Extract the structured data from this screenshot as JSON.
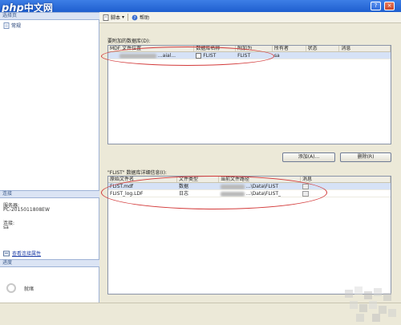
{
  "brand": {
    "prefix": "php",
    "suffix": "中文网"
  },
  "window_controls": {
    "help": "?",
    "close": "×"
  },
  "left_pane": {
    "select_page_header": "选择页",
    "select_page_item": "常规",
    "connection_header": "连接",
    "server_label": "服务器:",
    "server_value": "PC-2015011808EW",
    "connection_label": "连接:",
    "connection_value": "sa",
    "view_connection_link": "查看连接属性",
    "progress_header": "进度",
    "progress_status": "就绪"
  },
  "toolbar": {
    "script_label": "脚本",
    "help_label": "帮助"
  },
  "attach_section": {
    "label": "要附加的数据库(D):",
    "columns": [
      "MDF 文件位置",
      "数据库名称",
      "附加为",
      "所有者",
      "状态",
      "消息"
    ],
    "rows": [
      {
        "mdf": "...aial...",
        "db_name": "FLIST",
        "attach_as": "FLIST",
        "owner": "sa",
        "status": "",
        "message": ""
      }
    ]
  },
  "buttons": {
    "add": "添加(A)...",
    "remove": "删除(R)"
  },
  "details_section": {
    "label": "\"FLIST\" 数据库详细信息(I):",
    "columns": [
      "原始文件名",
      "文件类型",
      "当前文件路径",
      "消息"
    ],
    "rows": [
      {
        "file_name": "FLIST.mdf",
        "file_type": "数据",
        "path": "...\\Data\\FLIST",
        "message": ""
      },
      {
        "file_name": "FLIST_log.LDF",
        "file_type": "日志",
        "path": "...\\Data\\FLIST_",
        "message": ""
      }
    ]
  },
  "colors": {
    "accent": "#1f5fcf",
    "highlight": "#d33a3a",
    "selection": "#d6e2f6"
  }
}
